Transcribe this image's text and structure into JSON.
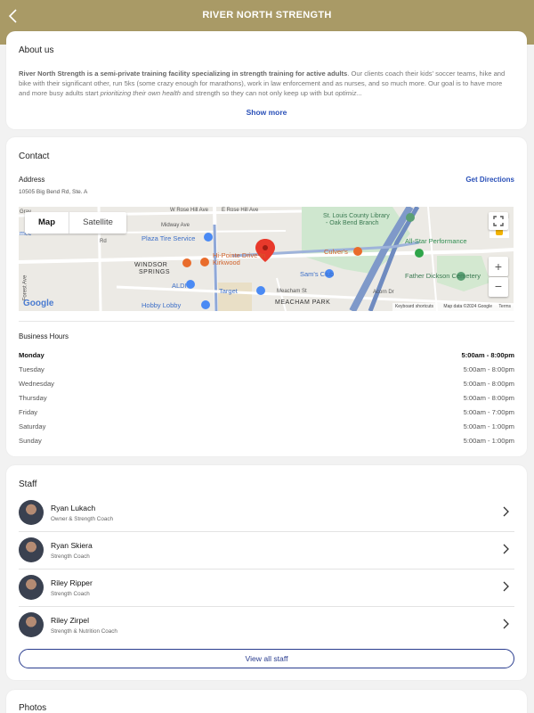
{
  "header": {
    "title": "RIVER NORTH STRENGTH",
    "back_icon": "chevron-left-icon"
  },
  "about": {
    "title": "About us",
    "desc_bold": "River North Strength is a semi-private training facility specializing in strength training for active adults",
    "desc_rest": ". Our clients coach their kids' soccer teams, hike and bike with their significant other, run 5ks (some crazy enough for marathons), work in law enforcement and as nurses, and so much more. Our goal is to have more and more busy adults start ",
    "desc_italic1": "prioritizing their own health",
    "desc_mid": " and strength so they can not only keep up with but ",
    "desc_italic2": "optimiz...",
    "show_more": "Show more"
  },
  "contact": {
    "title": "Contact",
    "address_label": "Address",
    "address_value": "10505 Big Bend Rd, Ste. A",
    "directions": "Get Directions",
    "map": {
      "tab_map": "Map",
      "tab_satellite": "Satellite",
      "labels": {
        "rose_w": "W Rose Hill Ave",
        "rose_e": "E Rose Hill Ave",
        "midway": "Midway Ave",
        "plaza": "Plaza Tire Service",
        "hipointe": "Hi-Pointe Drive-In",
        "kirkwood": "Kirkwood",
        "windsor": "WINDSOR",
        "springs": "SPRINGS",
        "aldi": "ALDI",
        "target": "Target",
        "hobby": "Hobby Lobby",
        "meacham_st": "Meacham St",
        "meacham_park": "MEACHAM PARK",
        "library1": "St. Louis County Library",
        "library2": "- Oak Bend Branch",
        "culvers": "Culver's",
        "allstar": "All-Star Performance",
        "cemetery": "Father Dickson Cemetery",
        "sams": "Sam's Club",
        "acorn": "Acorn Dr",
        "forest": "Forest Ave",
        "gray": "Gray",
        "rd": "Rd",
        "mec": "mec",
        "kbd": "Keyboard shortcuts",
        "mapdata": "Map data ©2024 Google",
        "terms": "Terms",
        "google": "Google"
      }
    },
    "hours_label": "Business Hours",
    "hours": [
      {
        "day": "Monday",
        "time": "5:00am - 8:00pm"
      },
      {
        "day": "Tuesday",
        "time": "5:00am - 8:00pm"
      },
      {
        "day": "Wednesday",
        "time": "5:00am - 8:00pm"
      },
      {
        "day": "Thursday",
        "time": "5:00am - 8:00pm"
      },
      {
        "day": "Friday",
        "time": "5:00am - 7:00pm"
      },
      {
        "day": "Saturday",
        "time": "5:00am - 1:00pm"
      },
      {
        "day": "Sunday",
        "time": "5:00am - 1:00pm"
      }
    ]
  },
  "staff": {
    "title": "Staff",
    "members": [
      {
        "name": "Ryan Lukach",
        "role": "Owner & Strength Coach"
      },
      {
        "name": "Ryan Skiera",
        "role": "Strength Coach"
      },
      {
        "name": "Riley Ripper",
        "role": "Strength Coach"
      },
      {
        "name": "Riley Zirpel",
        "role": "Strength & Nutrition Coach"
      }
    ],
    "view_all": "View all staff"
  },
  "photos": {
    "title": "Photos"
  },
  "colors": {
    "header": "#a99a66",
    "link": "#2a50b8",
    "button_border": "#2a3d8f"
  }
}
